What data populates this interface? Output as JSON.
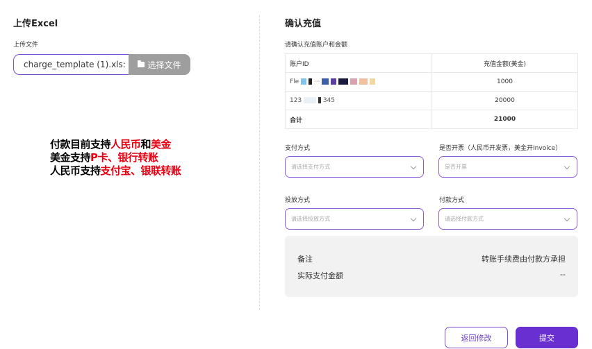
{
  "upload": {
    "title": "上传Excel",
    "file_label": "上传文件",
    "file_name": "charge_template (1).xls:",
    "choose_button": "选择文件"
  },
  "notice": {
    "line1": [
      "付款目前支持",
      "人民币",
      "和",
      "美金"
    ],
    "line2": [
      "美金支持",
      "P卡、银行转账"
    ],
    "line3": [
      "人民币支持",
      "支付宝、银联转账"
    ]
  },
  "confirm": {
    "title": "确认充值",
    "subtitle": "请确认充值账户和金额",
    "table": {
      "headers": [
        "账户ID",
        "充值金额(美金)"
      ],
      "rows": [
        {
          "id": "Fle ... t  Jcon (54976? 417496)",
          "amount": "1000"
        },
        {
          "id": "123 ... 345",
          "amount": "20000"
        }
      ],
      "total": {
        "label": "合计",
        "amount": "21000"
      }
    }
  },
  "form": {
    "payment_method": {
      "label": "支付方式",
      "placeholder": "请选择支付方式"
    },
    "invoice": {
      "label": "是否开票（人民币开发票，美金开Invoice）",
      "placeholder": "是否开票"
    },
    "delivery_method": {
      "label": "投放方式",
      "placeholder": "请选择投放方式"
    },
    "payer_method": {
      "label": "付款方式",
      "placeholder": "请选择付款方式"
    }
  },
  "summary": {
    "note_label": "备注",
    "note_value": "转账手续费由付款方承担",
    "actual_label": "实际支付金额",
    "actual_value": "--"
  },
  "actions": {
    "back": "返回修改",
    "submit": "提交"
  },
  "colors": {
    "accent": "#6a2fd0",
    "highlight_red": "#e60012"
  }
}
